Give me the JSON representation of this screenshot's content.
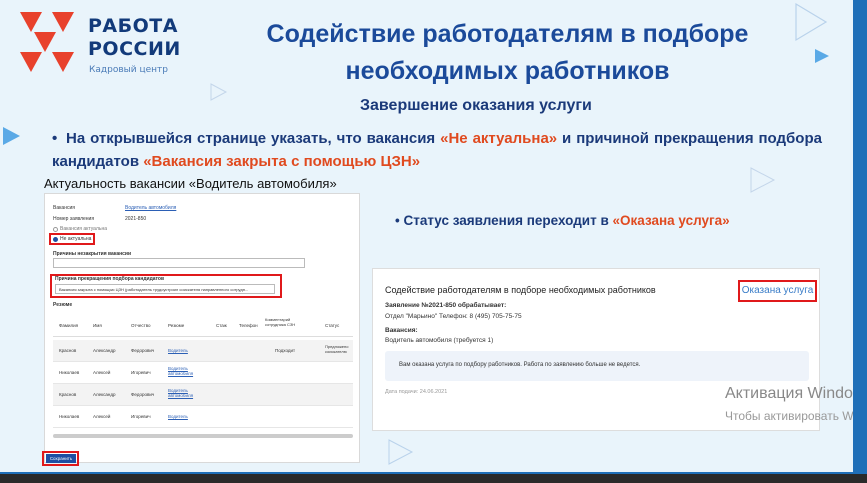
{
  "logo": {
    "line1": "РАБОТА",
    "line2": "РОССИИ",
    "sub": "Кадровый центр"
  },
  "title": "Содействие  работодателям в подборе необходимых работников",
  "subtitle": "Завершение оказания услуги",
  "bullet1": {
    "part1": "На открывшейся странице указать, что вакансия ",
    "red1": "«Не актуальна»",
    "part2": " и причиной прекращения подбора кандидатов ",
    "red2": "«Вакансия закрыта с помощью ЦЗН»"
  },
  "bullet2": {
    "part1": "Статус заявления переходит в ",
    "red1": "«Оказана услуга»"
  },
  "left_shot": {
    "caption": "Актуальность вакансии «Водитель автомобиля»",
    "vacancy_label": "Вакансия",
    "vacancy_value": "Водитель автомобиля",
    "app_label": "Номер заявления",
    "app_value": "2021-850",
    "radio1": "Вакансия актуальна",
    "radio2": "Не актуальна",
    "reasons_label": "Причины незакрытия вакансии",
    "stop_label": "Причина прекращения подбора кандидатов",
    "stop_value": "Вакансия закрыта с помощью ЦЗН (работодатель трудоустроил соискателя направленного сотрудн...",
    "resume_label": "Резюме",
    "columns": [
      "Фамилия",
      "Имя",
      "Отчество",
      "Резюме",
      "Стаж",
      "Телефон",
      "Комментарий сотрудника СЗН",
      "Статус"
    ],
    "rows": [
      [
        "Краснов",
        "Александр",
        "Федорович",
        "Водитель",
        "",
        "",
        "Подходит",
        "Предложено соискателю"
      ],
      [
        "Николаев",
        "Алексей",
        "Игоревич",
        "Водитель автомобиля",
        "",
        "",
        "",
        ""
      ],
      [
        "Краснов",
        "Александр",
        "Федорович",
        "Водитель автомобиля",
        "",
        "",
        "",
        ""
      ],
      [
        "Николаев",
        "Алексей",
        "Игоревич",
        "Водитель",
        "",
        "",
        "",
        ""
      ]
    ],
    "save": "Сохранить"
  },
  "right_shot": {
    "title": "Содействие работодателям в подборе необходимых работников",
    "status": "Оказана услуга",
    "app_line": "Заявление №2021-850 обрабатывает:",
    "office_line": "Отдел \"Марьино\" Телефон: 8 (495) 705-75-75",
    "vacancy_label": "Вакансия:",
    "vacancy_value": "Водитель автомобиля (требуется 1)",
    "note": "Вам оказана услуга по подбору работников. Работа по заявлению больше не ведется.",
    "date": "Дата подачи: 24.06.2021"
  },
  "watermark": {
    "line1": "Активация Windows",
    "line2": "Чтобы активировать Windows"
  },
  "colors": {
    "title": "#1b4a9a",
    "accent": "#e04a1f",
    "frame": "#e0191b"
  }
}
